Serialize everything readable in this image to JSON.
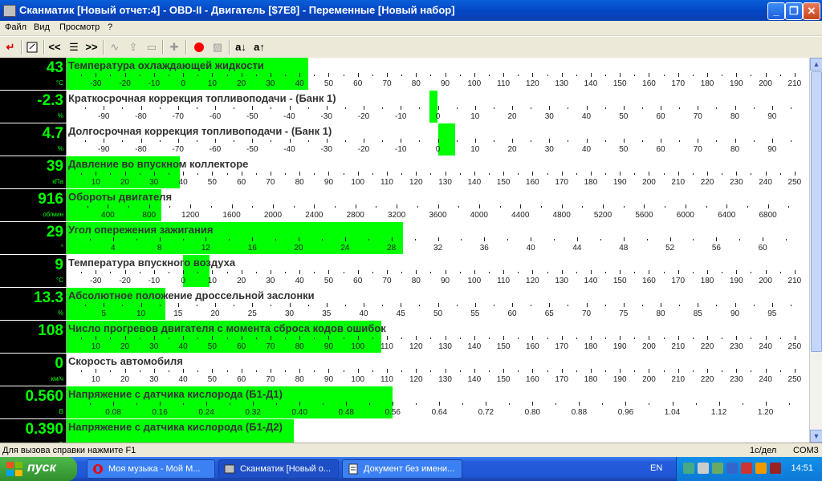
{
  "window": {
    "title": "Сканматик [Новый отчет:4] - OBD-II - Двигатель [$7E8] - Переменные [Новый набор]"
  },
  "menu": [
    "Файл",
    "Вид",
    "Просмотр",
    "?"
  ],
  "toolbar": {
    "icons": [
      "exit-icon",
      "report-icon",
      "prev-icon",
      "list-icon",
      "next-icon",
      "wave-icon",
      "upload-icon",
      "print-icon",
      "plugin-icon",
      "record-icon",
      "image-icon",
      "sort-asc-icon",
      "sort-desc-icon"
    ],
    "sort_asc_label": "a↓",
    "sort_desc_label": "a↑",
    "prev_label": "<<",
    "next_label": ">>",
    "record_color": "#ff0000"
  },
  "gauges": [
    {
      "name": "Температура охлаждающей жидкости",
      "value": "43",
      "unit": "°C",
      "min": -40,
      "max": 215,
      "fill_from": -40,
      "fill_to": 43,
      "labels": [
        -30,
        -20,
        -10,
        0,
        10,
        20,
        30,
        40,
        50,
        60,
        70,
        80,
        90,
        100,
        110,
        120,
        130,
        140,
        150,
        160,
        170,
        180,
        190,
        200,
        210
      ]
    },
    {
      "name": "Краткосрочная коррекция топливоподачи - (Банк 1)",
      "value": "-2.3",
      "unit": "%",
      "min": -100,
      "max": 100,
      "fill_from": -2.3,
      "fill_to": 0,
      "labels": [
        -90,
        -80,
        -70,
        -60,
        -50,
        -40,
        -30,
        -20,
        -10,
        0,
        10,
        20,
        30,
        40,
        50,
        60,
        70,
        80,
        90
      ]
    },
    {
      "name": "Долгосрочная коррекция топливоподачи -  (Банк 1)",
      "value": "4.7",
      "unit": "%",
      "min": -100,
      "max": 100,
      "fill_from": 0,
      "fill_to": 4.7,
      "labels": [
        -90,
        -80,
        -70,
        -60,
        -50,
        -40,
        -30,
        -20,
        -10,
        0,
        10,
        20,
        30,
        40,
        50,
        60,
        70,
        80,
        90
      ]
    },
    {
      "name": "Давление во впускном коллекторе",
      "value": "39",
      "unit": "кПа",
      "min": 0,
      "max": 255,
      "fill_from": 0,
      "fill_to": 39,
      "labels": [
        10,
        20,
        30,
        40,
        50,
        60,
        70,
        80,
        90,
        100,
        110,
        120,
        130,
        140,
        150,
        160,
        170,
        180,
        190,
        200,
        210,
        220,
        230,
        240,
        250
      ]
    },
    {
      "name": "Обороты двигателя",
      "value": "916",
      "unit": "об/мин",
      "min": 0,
      "max": 7200,
      "fill_from": 0,
      "fill_to": 916,
      "labels": [
        400,
        800,
        1200,
        1600,
        2000,
        2400,
        2800,
        3200,
        3600,
        4000,
        4400,
        4800,
        5200,
        5600,
        6000,
        6400,
        6800
      ]
    },
    {
      "name": "Угол опережения зажигания",
      "value": "29",
      "unit": "°",
      "min": 0,
      "max": 64,
      "fill_from": 0,
      "fill_to": 29,
      "labels": [
        4,
        8,
        12,
        16,
        20,
        24,
        28,
        32,
        36,
        40,
        44,
        48,
        52,
        56,
        60
      ]
    },
    {
      "name": "Температура впускного воздуха",
      "value": "9",
      "unit": "°C",
      "min": -40,
      "max": 215,
      "fill_from": 0,
      "fill_to": 9,
      "labels": [
        -30,
        -20,
        -10,
        0,
        10,
        20,
        30,
        40,
        50,
        60,
        70,
        80,
        90,
        100,
        110,
        120,
        130,
        140,
        150,
        160,
        170,
        180,
        190,
        200,
        210
      ]
    },
    {
      "name": "Абсолютное положение дроссельной заслонки",
      "value": "13.3",
      "unit": "%",
      "min": 0,
      "max": 100,
      "fill_from": 0,
      "fill_to": 13.3,
      "labels": [
        5,
        10,
        15,
        20,
        25,
        30,
        35,
        40,
        45,
        50,
        55,
        60,
        65,
        70,
        75,
        80,
        85,
        90,
        95
      ]
    },
    {
      "name": "Число прогревов двигателя с момента сброса кодов ошибок",
      "value": "108",
      "unit": "",
      "min": 0,
      "max": 255,
      "fill_from": 0,
      "fill_to": 108,
      "labels": [
        10,
        20,
        30,
        40,
        50,
        60,
        70,
        80,
        90,
        100,
        110,
        120,
        130,
        140,
        150,
        160,
        170,
        180,
        190,
        200,
        210,
        220,
        230,
        240,
        250
      ]
    },
    {
      "name": "Скорость автомобиля",
      "value": "0",
      "unit": "км/ч",
      "min": 0,
      "max": 255,
      "fill_from": 0,
      "fill_to": 0,
      "labels": [
        10,
        20,
        30,
        40,
        50,
        60,
        70,
        80,
        90,
        100,
        110,
        120,
        130,
        140,
        150,
        160,
        170,
        180,
        190,
        200,
        210,
        220,
        230,
        240,
        250
      ]
    },
    {
      "name": "Напряжение с датчика кислорода (Б1-Д1)",
      "value": "0.560",
      "unit": "В",
      "min": 0,
      "max": 1.275,
      "fill_from": 0,
      "fill_to": 0.56,
      "labels": [
        "0.08",
        "0.16",
        "0.24",
        "0.32",
        "0.40",
        "0.48",
        "0.56",
        "0.64",
        "0.72",
        "0.80",
        "0.88",
        "0.96",
        "1.04",
        "1.12",
        "1.20"
      ]
    },
    {
      "name": "Напряжение с датчика кислорода (Б1-Д2)",
      "value": "0.390",
      "unit": "В",
      "min": 0,
      "max": 1.275,
      "fill_from": 0,
      "fill_to": 0.39,
      "labels": []
    }
  ],
  "status": {
    "help": "Для вызова справки нажмите F1",
    "rate": "1с/дел",
    "port": "COM3"
  },
  "taskbar": {
    "start_label": "пуск",
    "tasks": [
      {
        "label": "Моя музыка - Мой М...",
        "icon": "opera-icon"
      },
      {
        "label": "Сканматик [Новый о...",
        "icon": "app-icon"
      },
      {
        "label": "Документ без имени...",
        "icon": "document-icon"
      }
    ],
    "lang": "EN",
    "clock": "14:51"
  },
  "colors": {
    "fill": "#00ff00",
    "value_bg": "#000000",
    "value_text": "#00ff00",
    "titlebar": "#0447c6"
  }
}
